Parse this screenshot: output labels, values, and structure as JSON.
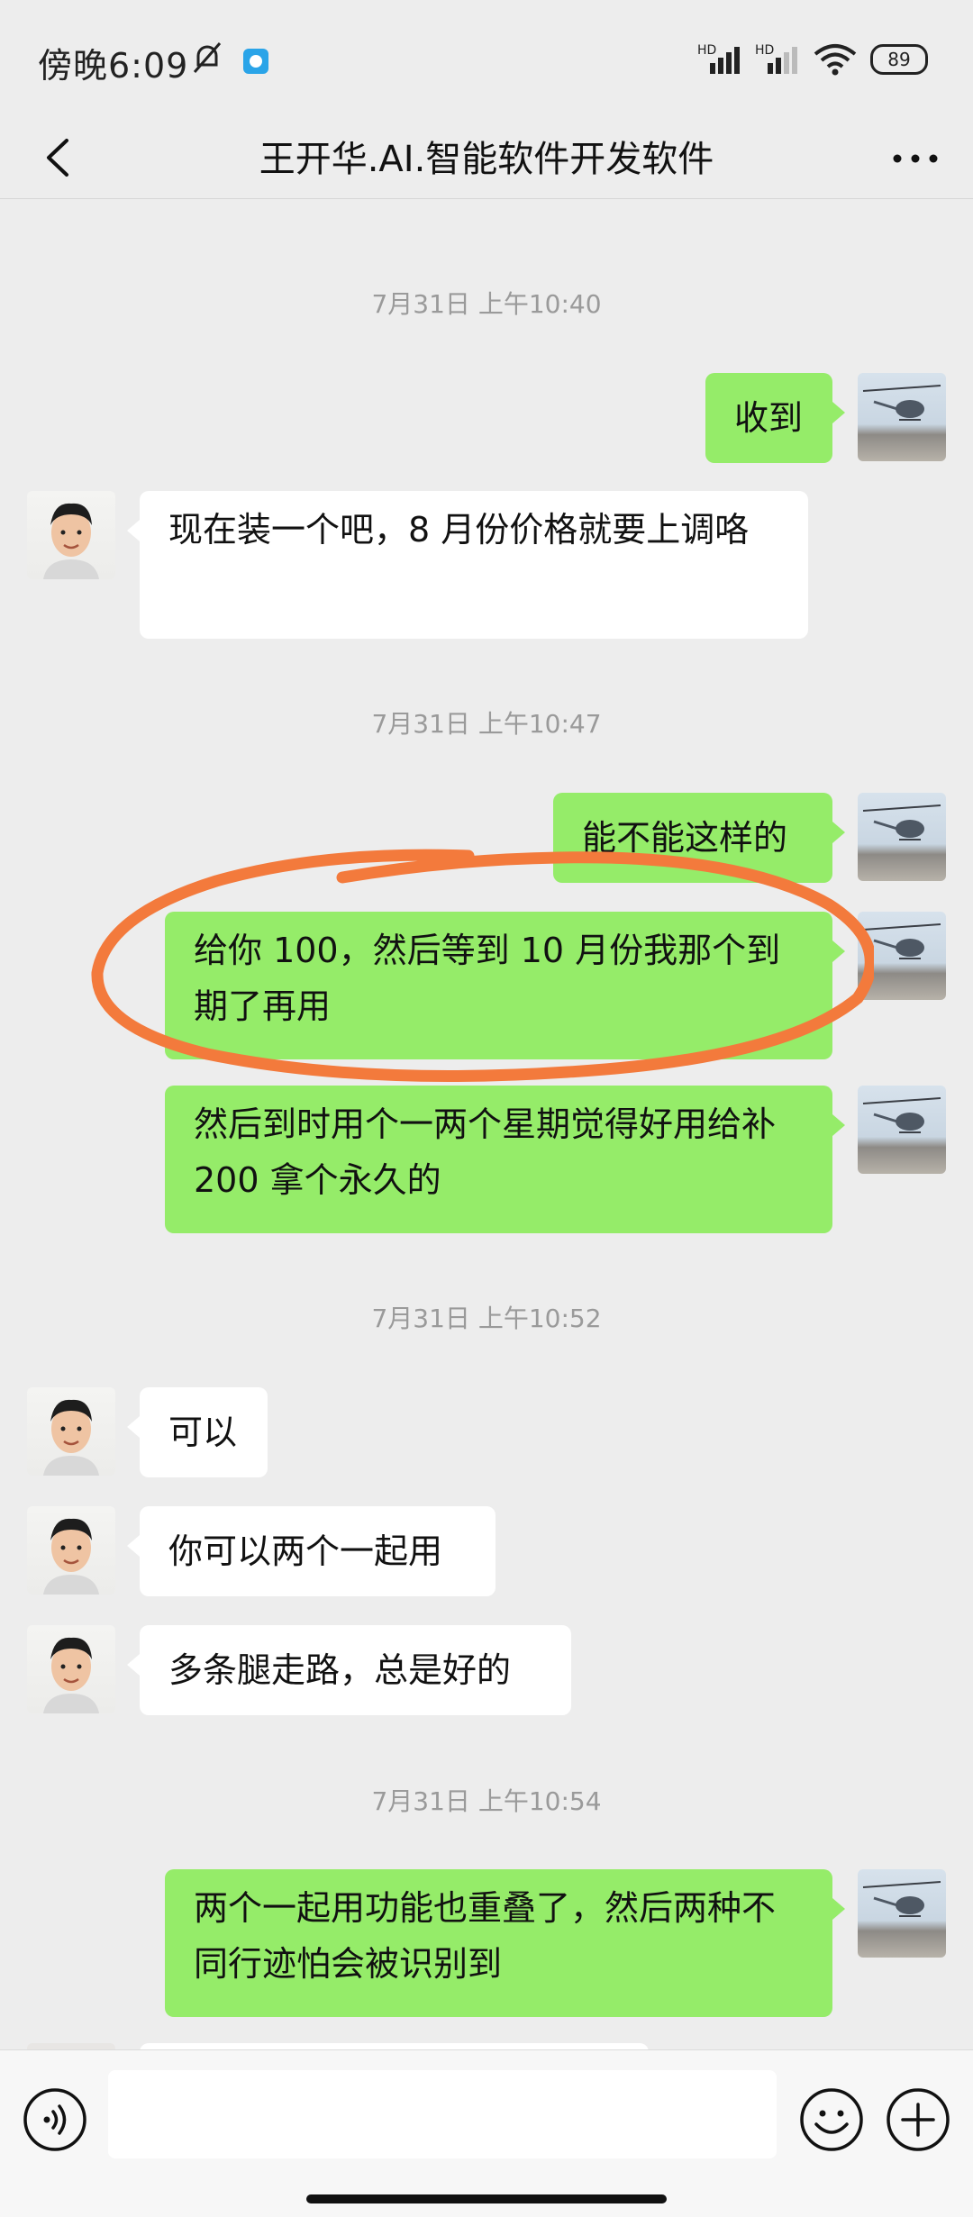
{
  "status": {
    "time": "傍晚6:09",
    "battery": "89",
    "network": "HD"
  },
  "header": {
    "title": "王开华.AI.智能软件开发软件"
  },
  "messages": [
    {
      "type": "time",
      "text": "7月31日 上午10:40"
    },
    {
      "type": "me",
      "text": "收到"
    },
    {
      "type": "other",
      "text": "现在装一个吧，8 月份价格就要上调咯"
    },
    {
      "type": "time",
      "text": "7月31日 上午10:47"
    },
    {
      "type": "me",
      "text": "能不能这样的"
    },
    {
      "type": "me",
      "text": "给你 100，然后等到 10 月份我那个到期了再用"
    },
    {
      "type": "me",
      "text": "然后到时用个一两个星期觉得好用给补 200 拿个永久的"
    },
    {
      "type": "time",
      "text": "7月31日 上午10:52"
    },
    {
      "type": "other",
      "text": "可以"
    },
    {
      "type": "other",
      "text": "你可以两个一起用"
    },
    {
      "type": "other",
      "text": "多条腿走路，总是好的"
    },
    {
      "type": "time",
      "text": "7月31日 上午10:54"
    },
    {
      "type": "me",
      "text": "两个一起用功能也重叠了，然后两种不同行迹怕会被识别到"
    }
  ],
  "icons": {
    "back": "chevron-left-icon",
    "more": "more-horizontal-icon",
    "voice": "voice-icon",
    "emoji": "emoji-icon",
    "plus": "plus-icon"
  },
  "colors": {
    "my_bubble": "#95ec69",
    "other_bubble": "#ffffff",
    "annotation_circle": "#f37a3c"
  }
}
